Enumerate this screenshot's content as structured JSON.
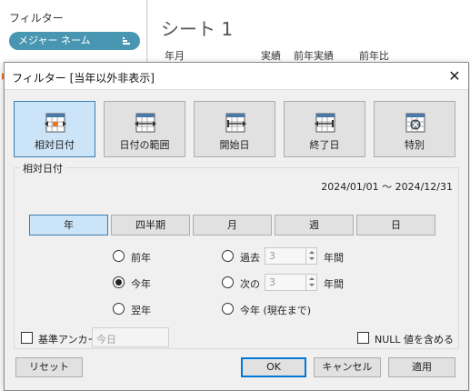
{
  "background": {
    "filters_title": "フィルター",
    "filter_pill": "メジャー ネーム",
    "sheet_title": "シート 1",
    "headers": [
      "年月",
      "実績",
      "前年実績",
      "前年比"
    ]
  },
  "dialog": {
    "title": "フィルター [当年以外非表示]",
    "close_glyph": "✕",
    "modes": [
      {
        "label": "相対日付",
        "icon": "calendar-relative-icon",
        "selected": true
      },
      {
        "label": "日付の範囲",
        "icon": "calendar-range-icon",
        "selected": false
      },
      {
        "label": "開始日",
        "icon": "calendar-start-icon",
        "selected": false
      },
      {
        "label": "終了日",
        "icon": "calendar-end-icon",
        "selected": false
      },
      {
        "label": "特別",
        "icon": "calendar-special-icon",
        "selected": false
      }
    ],
    "group_label": "相対日付",
    "date_range": "2024/01/01 ～ 2024/12/31",
    "periods": [
      {
        "label": "年",
        "selected": true
      },
      {
        "label": "四半期",
        "selected": false
      },
      {
        "label": "月",
        "selected": false
      },
      {
        "label": "週",
        "selected": false
      },
      {
        "label": "日",
        "selected": false
      }
    ],
    "radios_left": [
      {
        "label": "前年",
        "checked": false
      },
      {
        "label": "今年",
        "checked": true
      },
      {
        "label": "翌年",
        "checked": false
      }
    ],
    "radio_past": {
      "label": "過去",
      "value": "3",
      "unit": "年間",
      "checked": false
    },
    "radio_next": {
      "label": "次の",
      "value": "3",
      "unit": "年間",
      "checked": false
    },
    "radio_todate": {
      "label": "今年 (現在まで)",
      "checked": false
    },
    "anchor": {
      "label": "基準アンカー",
      "value": "今日",
      "checked": false
    },
    "include_null": {
      "label": "NULL 値を含める",
      "checked": false
    },
    "buttons": {
      "reset": "リセット",
      "ok": "OK",
      "cancel": "キャンセル",
      "apply": "適用"
    },
    "accent": "#cce4f7",
    "accent_border": "#3c7fb1"
  }
}
